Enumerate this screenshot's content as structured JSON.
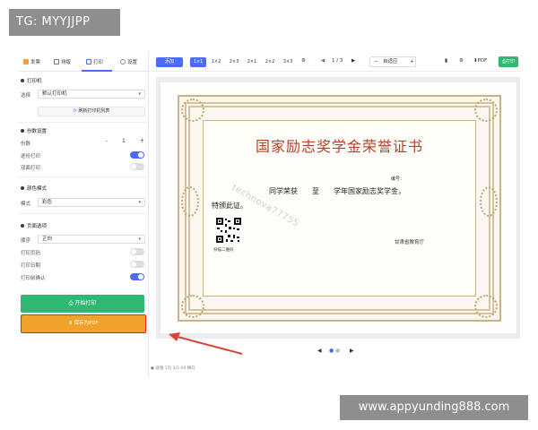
{
  "overlay": {
    "top_tag": "TG: MYYJJPP",
    "bottom_tag": "www.appyunding888.com"
  },
  "tabs": [
    {
      "label": "发票",
      "icon": "invoice-icon"
    },
    {
      "label": "排版",
      "icon": "layout-icon"
    },
    {
      "label": "打印",
      "icon": "printer-icon"
    },
    {
      "label": "设置",
      "icon": "settings-icon"
    }
  ],
  "printer": {
    "section_title": "打印机",
    "select_label": "选择",
    "select_value": "默认打印机",
    "refresh_label": "刷新打印机列表"
  },
  "params": {
    "section_title": "份数设置",
    "copies_label": "份数",
    "copies_value": "1",
    "minus": "-",
    "plus": "+",
    "collate_label": "逐份打印",
    "duplex_label": "双面打印"
  },
  "color": {
    "section_title": "颜色模式",
    "mode_label": "模式",
    "mode_value": "彩色"
  },
  "page_opts": {
    "section_title": "页面选项",
    "order_label": "顺序",
    "order_value": "正向",
    "opt1": "打印页码",
    "opt2": "打印日期",
    "opt3": "打印前确认"
  },
  "actions": {
    "print": "开始打印",
    "save_pdf": "保存为PDF"
  },
  "toolbar": {
    "add_label": "添加",
    "grids": [
      "1×1",
      "1×2",
      "2×3",
      "2×1",
      "2×2",
      "3×3"
    ],
    "page_indicator": "1 / 3",
    "zoom_minus": "−",
    "zoom_label": "自适应",
    "zoom_plus": "+",
    "pdf_label": "PDF",
    "print_label": "打印"
  },
  "certificate": {
    "title": "国家励志奖学金荣誉证书",
    "number_label": "编号：",
    "line1": "同学荣获　　至　　学年国家励志奖学金，",
    "line2": "特颁此证。",
    "qr_label": "扫描二维码",
    "issuer": "甘肃省教育厅",
    "watermark": "technova77755"
  },
  "status": {
    "text": "● 就绪   1页   1/1   A4 横向"
  },
  "colors": {
    "accent": "#4a6cf7",
    "print_green": "#2eb872",
    "pdf_orange": "#f0a32a",
    "highlight_red": "#e2261f",
    "cert_title": "#b8412c"
  }
}
